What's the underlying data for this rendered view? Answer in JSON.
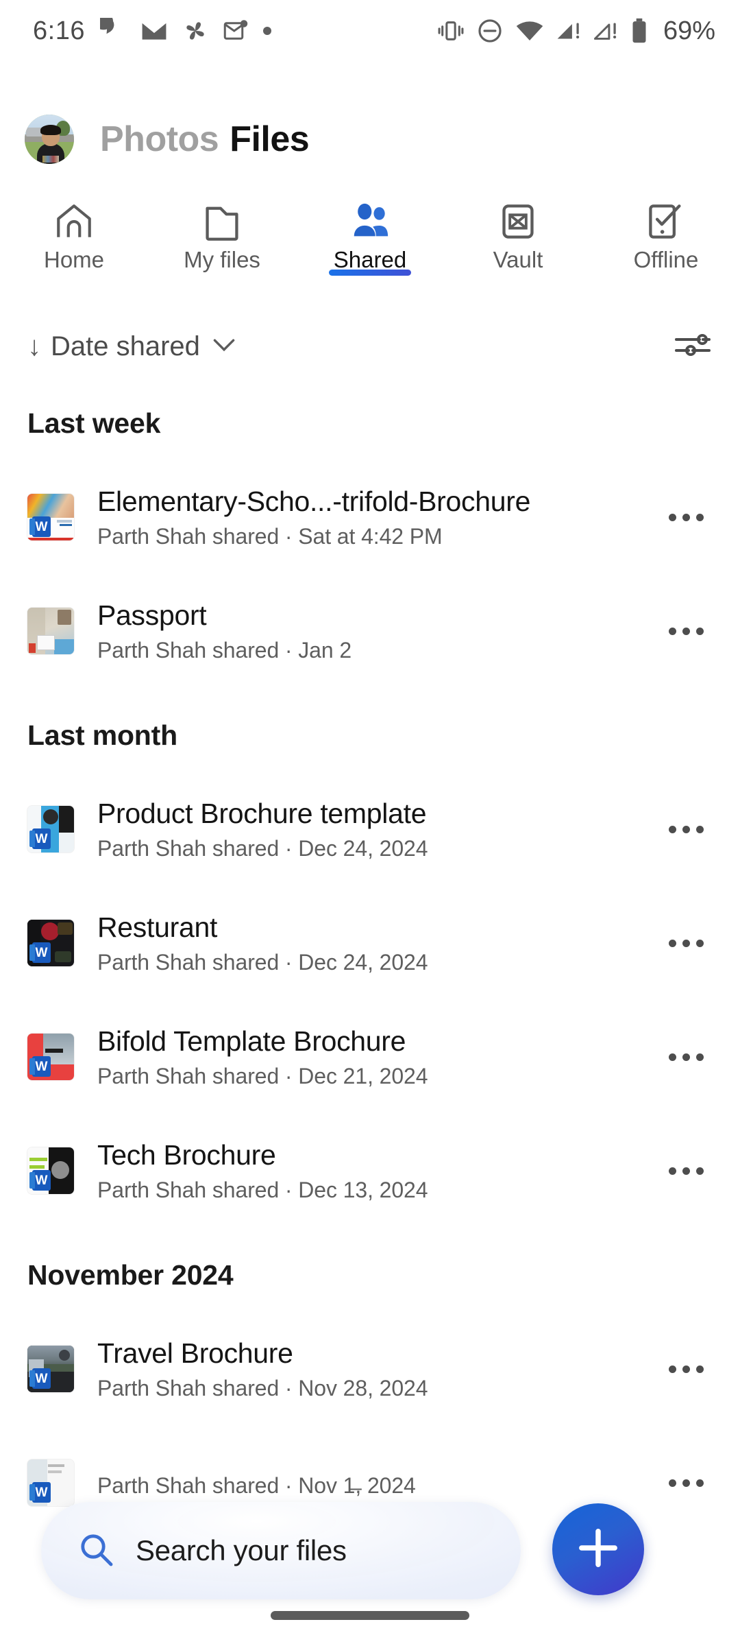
{
  "status_bar": {
    "time": "6:16",
    "battery_percent": "69%",
    "left_icons": [
      "chat-bubble-icon",
      "gmail-icon",
      "pinwheel-icon",
      "mail-unread-icon",
      "overflow-dot-icon"
    ],
    "right_icons": [
      "vibrate-icon",
      "do-not-disturb-icon",
      "wifi-icon",
      "signal-sim1-alert-icon",
      "signal-sim2-alert-icon",
      "battery-icon"
    ]
  },
  "header": {
    "avatar_name": "user-avatar",
    "title_inactive": "Photos",
    "title_active": "Files"
  },
  "tabs": [
    {
      "label": "Home",
      "icon": "home-icon",
      "active": false
    },
    {
      "label": "My files",
      "icon": "folder-icon",
      "active": false
    },
    {
      "label": "Shared",
      "icon": "people-icon",
      "active": true
    },
    {
      "label": "Vault",
      "icon": "vault-icon",
      "active": false
    },
    {
      "label": "Offline",
      "icon": "offline-icon",
      "active": false
    }
  ],
  "sort_bar": {
    "direction_icon": "arrow-down-icon",
    "label": "Date shared",
    "chevron_icon": "chevron-down-icon",
    "filter_icon": "filter-sliders-icon"
  },
  "groups": [
    {
      "title": "Last week",
      "items": [
        {
          "name": "Elementary-Scho...-trifold-Brochure",
          "subtitle": "Parth Shah shared · Sat at 4:42 PM",
          "art": "art-school",
          "badge": "W"
        },
        {
          "name": "Passport",
          "subtitle": "Parth Shah shared · Jan 2",
          "art": "art-passport",
          "badge": ""
        }
      ]
    },
    {
      "title": "Last month",
      "items": [
        {
          "name": "Product Brochure template",
          "subtitle": "Parth Shah shared · Dec 24, 2024",
          "art": "art-product",
          "badge": "W"
        },
        {
          "name": "Resturant",
          "subtitle": "Parth Shah shared · Dec 24, 2024",
          "art": "art-rest",
          "badge": "W"
        },
        {
          "name": "Bifold Template Brochure",
          "subtitle": "Parth Shah shared · Dec 21, 2024",
          "art": "art-bifold",
          "badge": "W"
        },
        {
          "name": "Tech Brochure",
          "subtitle": "Parth Shah shared · Dec 13, 2024",
          "art": "art-tech",
          "badge": "W"
        }
      ]
    },
    {
      "title": "November 2024",
      "items": [
        {
          "name": "Travel Brochure",
          "subtitle": "Parth Shah shared · Nov 28, 2024",
          "art": "art-travel",
          "badge": "W"
        },
        {
          "name": "",
          "subtitle": "Parth Shah shared · Nov 1̶, 2024",
          "art": "art-partial",
          "badge": "W"
        }
      ]
    }
  ],
  "search": {
    "icon": "search-icon",
    "placeholder": "Search your files"
  },
  "fab": {
    "icon": "plus-icon",
    "label": "Add"
  },
  "colors": {
    "accent_blue": "#1b72e8",
    "fab_gradient_start": "#1565d8",
    "fab_gradient_end": "#4338ca",
    "word_blue": "#185abd",
    "text_primary": "#141414",
    "text_secondary": "#5e5e5e"
  }
}
